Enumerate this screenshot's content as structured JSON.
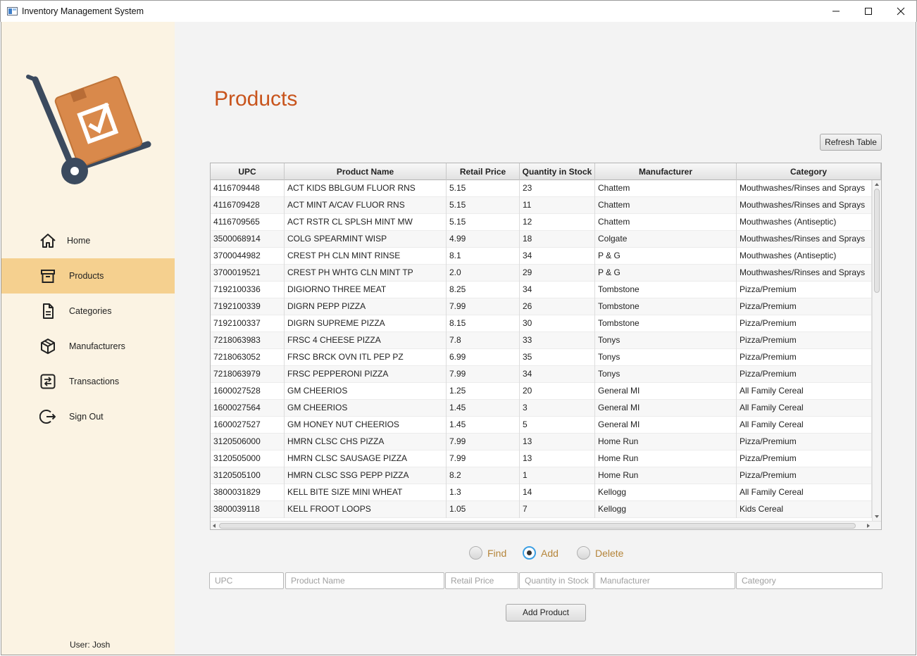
{
  "window": {
    "title": "Inventory Management System"
  },
  "sidebar": {
    "items": [
      {
        "label": "Home",
        "icon": "home-icon"
      },
      {
        "label": "Products",
        "icon": "archive-box-icon",
        "active": true
      },
      {
        "label": "Categories",
        "icon": "document-icon"
      },
      {
        "label": "Manufacturers",
        "icon": "cube-icon"
      },
      {
        "label": "Transactions",
        "icon": "swap-arrows-icon"
      },
      {
        "label": "Sign Out",
        "icon": "sign-out-icon"
      }
    ],
    "user_label": "User: Josh"
  },
  "colors": {
    "accent": "#c8541c",
    "sidebar_bg": "#fbf3e3",
    "active_item": "#f5d08f",
    "radio_label": "#b5853a"
  },
  "main": {
    "title": "Products",
    "refresh_label": "Refresh Table",
    "columns": [
      "UPC",
      "Product Name",
      "Retail Price",
      "Quantity in Stock",
      "Manufacturer",
      "Category"
    ],
    "rows": [
      [
        "4116709448",
        "ACT KIDS BBLGUM FLUOR RNS",
        "5.15",
        "23",
        "Chattem",
        "Mouthwashes/Rinses and Sprays"
      ],
      [
        "4116709428",
        "ACT MINT A/CAV FLUOR RNS",
        "5.15",
        "11",
        "Chattem",
        "Mouthwashes/Rinses and Sprays"
      ],
      [
        "4116709565",
        "ACT RSTR CL SPLSH MINT MW",
        "5.15",
        "12",
        "Chattem",
        "Mouthwashes (Antiseptic)"
      ],
      [
        "3500068914",
        "COLG SPEARMINT WISP",
        "4.99",
        "18",
        "Colgate",
        "Mouthwashes/Rinses and Sprays"
      ],
      [
        "3700044982",
        "CREST PH CLN MINT RINSE",
        "8.1",
        "34",
        "P & G",
        "Mouthwashes (Antiseptic)"
      ],
      [
        "3700019521",
        "CREST PH WHTG CLN MINT TP",
        "2.0",
        "29",
        "P & G",
        "Mouthwashes/Rinses and Sprays"
      ],
      [
        "7192100336",
        "DIGIORNO THREE MEAT",
        "8.25",
        "34",
        "Tombstone",
        "Pizza/Premium"
      ],
      [
        "7192100339",
        "DIGRN PEPP PIZZA",
        "7.99",
        "26",
        "Tombstone",
        "Pizza/Premium"
      ],
      [
        "7192100337",
        "DIGRN SUPREME PIZZA",
        "8.15",
        "30",
        "Tombstone",
        "Pizza/Premium"
      ],
      [
        "7218063983",
        "FRSC 4 CHEESE PIZZA",
        "7.8",
        "33",
        "Tonys",
        "Pizza/Premium"
      ],
      [
        "7218063052",
        "FRSC BRCK OVN ITL PEP PZ",
        "6.99",
        "35",
        "Tonys",
        "Pizza/Premium"
      ],
      [
        "7218063979",
        "FRSC PEPPERONI PIZZA",
        "7.99",
        "34",
        "Tonys",
        "Pizza/Premium"
      ],
      [
        "1600027528",
        "GM CHEERIOS",
        "1.25",
        "20",
        "General MI",
        "All Family Cereal"
      ],
      [
        "1600027564",
        "GM CHEERIOS",
        "1.45",
        "3",
        "General MI",
        "All Family Cereal"
      ],
      [
        "1600027527",
        "GM HONEY NUT CHEERIOS",
        "1.45",
        "5",
        "General MI",
        "All Family Cereal"
      ],
      [
        "3120506000",
        "HMRN CLSC CHS PIZZA",
        "7.99",
        "13",
        "Home Run",
        "Pizza/Premium"
      ],
      [
        "3120505000",
        "HMRN CLSC SAUSAGE PIZZA",
        "7.99",
        "13",
        "Home Run",
        "Pizza/Premium"
      ],
      [
        "3120505100",
        "HMRN CLSC SSG PEPP PIZZA",
        "8.2",
        "1",
        "Home Run",
        "Pizza/Premium"
      ],
      [
        "3800031829",
        "KELL BITE SIZE MINI WHEAT",
        "1.3",
        "14",
        "Kellogg",
        "All Family Cereal"
      ],
      [
        "3800039118",
        "KELL FROOT LOOPS",
        "1.05",
        "7",
        "Kellogg",
        "Kids Cereal"
      ]
    ],
    "modes": [
      {
        "label": "Find",
        "checked": false
      },
      {
        "label": "Add",
        "checked": true
      },
      {
        "label": "Delete",
        "checked": false
      }
    ],
    "form": {
      "upc_placeholder": "UPC",
      "name_placeholder": "Product Name",
      "price_placeholder": "Retail Price",
      "qty_placeholder": "Quantity in Stock",
      "manufacturer_placeholder": "Manufacturer",
      "category_placeholder": "Category",
      "upc_value": "",
      "name_value": "",
      "price_value": "",
      "qty_value": "",
      "manufacturer_value": "",
      "category_value": ""
    },
    "add_button_label": "Add Product"
  }
}
